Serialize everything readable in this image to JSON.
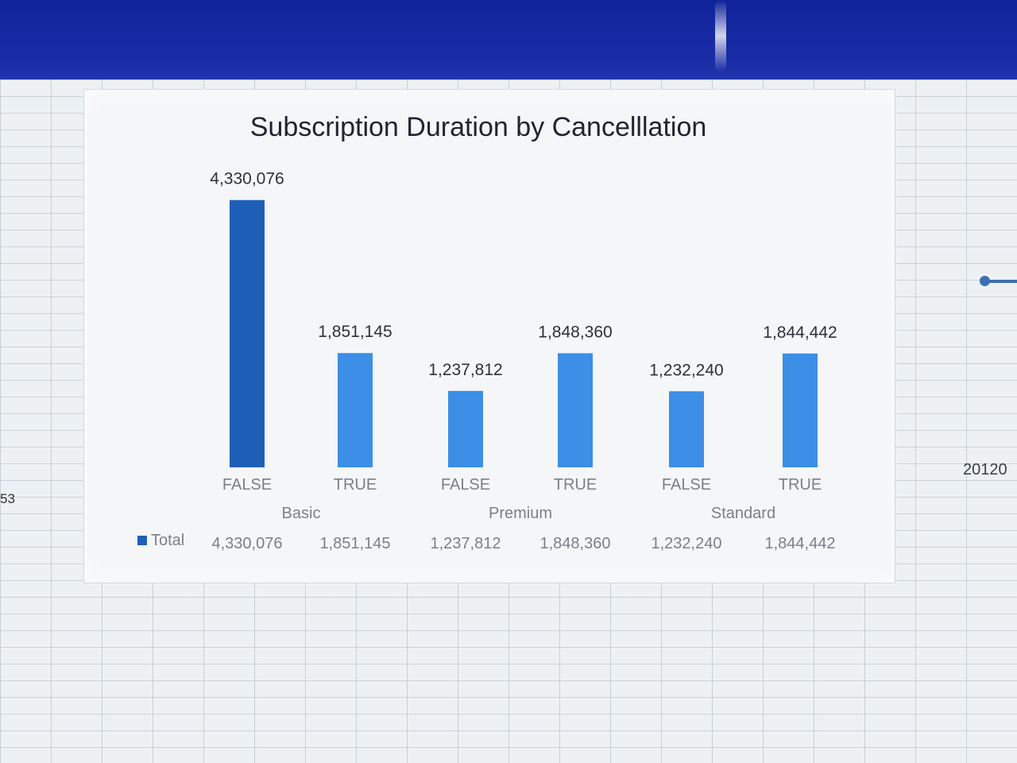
{
  "sheet": {
    "row_label_left": "53",
    "cell_right": "20120"
  },
  "chart_data": {
    "type": "bar",
    "title": "Subscription Duration by Cancelllation",
    "groups": [
      "Basic",
      "Premium",
      "Standard"
    ],
    "categories": [
      "FALSE",
      "TRUE",
      "FALSE",
      "TRUE",
      "FALSE",
      "TRUE"
    ],
    "series": [
      {
        "name": "Total",
        "values": [
          4330076,
          1851145,
          1237812,
          1848360,
          1232240,
          1844442
        ]
      }
    ],
    "data_labels": [
      "4,330,076",
      "1,851,145",
      "1,237,812",
      "1,848,360",
      "1,232,240",
      "1,844,442"
    ],
    "data_table": {
      "legend_label": "Total",
      "values": [
        "4,330,076",
        "1,851,145",
        "1,237,812",
        "1,848,360",
        "1,232,240",
        "1,844,442"
      ]
    },
    "ylim": [
      0,
      4700000
    ],
    "colors": {
      "bar_dark": "#1f5fb8",
      "bar_light": "#3c8ee6",
      "label": "#2d3138",
      "axis_text": "#7a8088"
    },
    "grid": false,
    "legend": "data-table"
  }
}
